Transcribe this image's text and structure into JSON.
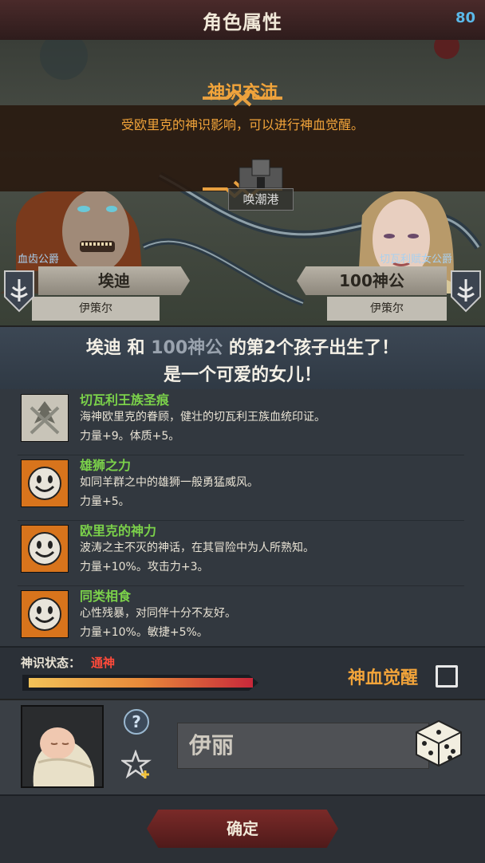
{
  "header": {
    "title": "角色属性",
    "counter": "80"
  },
  "event": {
    "title": "神识充沛",
    "text": "受欧里克的神识影响，可以进行神血觉醒。"
  },
  "map": {
    "location": "唤潮港"
  },
  "father": {
    "rank": "血齿公爵",
    "name": "埃迪",
    "clan": "伊策尔"
  },
  "mother": {
    "rank": "切瓦利赋女公爵",
    "name": "100神公",
    "clan": "伊策尔"
  },
  "announcement": {
    "line1_name1": "埃迪",
    "line1_and": " 和 ",
    "line1_name2": "100神公",
    "line1_rest": " 的第2个孩子出生了！",
    "line2": "是一个可爱的女儿！"
  },
  "traits": [
    {
      "name": "切瓦利王族圣痕",
      "desc": "海神欧里克的眷顾，健壮的切瓦利王族血统印证。",
      "stat": "力量+9。体质+5。",
      "icon": "crest-icon"
    },
    {
      "name": "雄狮之力",
      "desc": "如同羊群之中的雄狮一般勇猛威风。",
      "stat": "力量+5。",
      "icon": "smiley-icon"
    },
    {
      "name": "欧里克的神力",
      "desc": "波涛之主不灭的神话，在其冒险中为人所熟知。",
      "stat": "力量+10%。攻击力+3。",
      "icon": "smiley-icon"
    },
    {
      "name": "同类相食",
      "desc": "心性残暴，对同伴十分不友好。",
      "stat": "力量+10%。敏捷+5%。",
      "icon": "smiley-icon"
    }
  ],
  "status": {
    "label": "神识状态：",
    "value": "通神",
    "level": 0.95
  },
  "awaken": {
    "label": "神血觉醒",
    "checked": false
  },
  "child": {
    "name": "伊丽"
  },
  "footer": {
    "confirm_label": "确定"
  },
  "colors": {
    "accent": "#f2a43a",
    "trait_name": "#7bd14a",
    "status": "#ff4a3a",
    "counter": "#5ab8e8"
  }
}
